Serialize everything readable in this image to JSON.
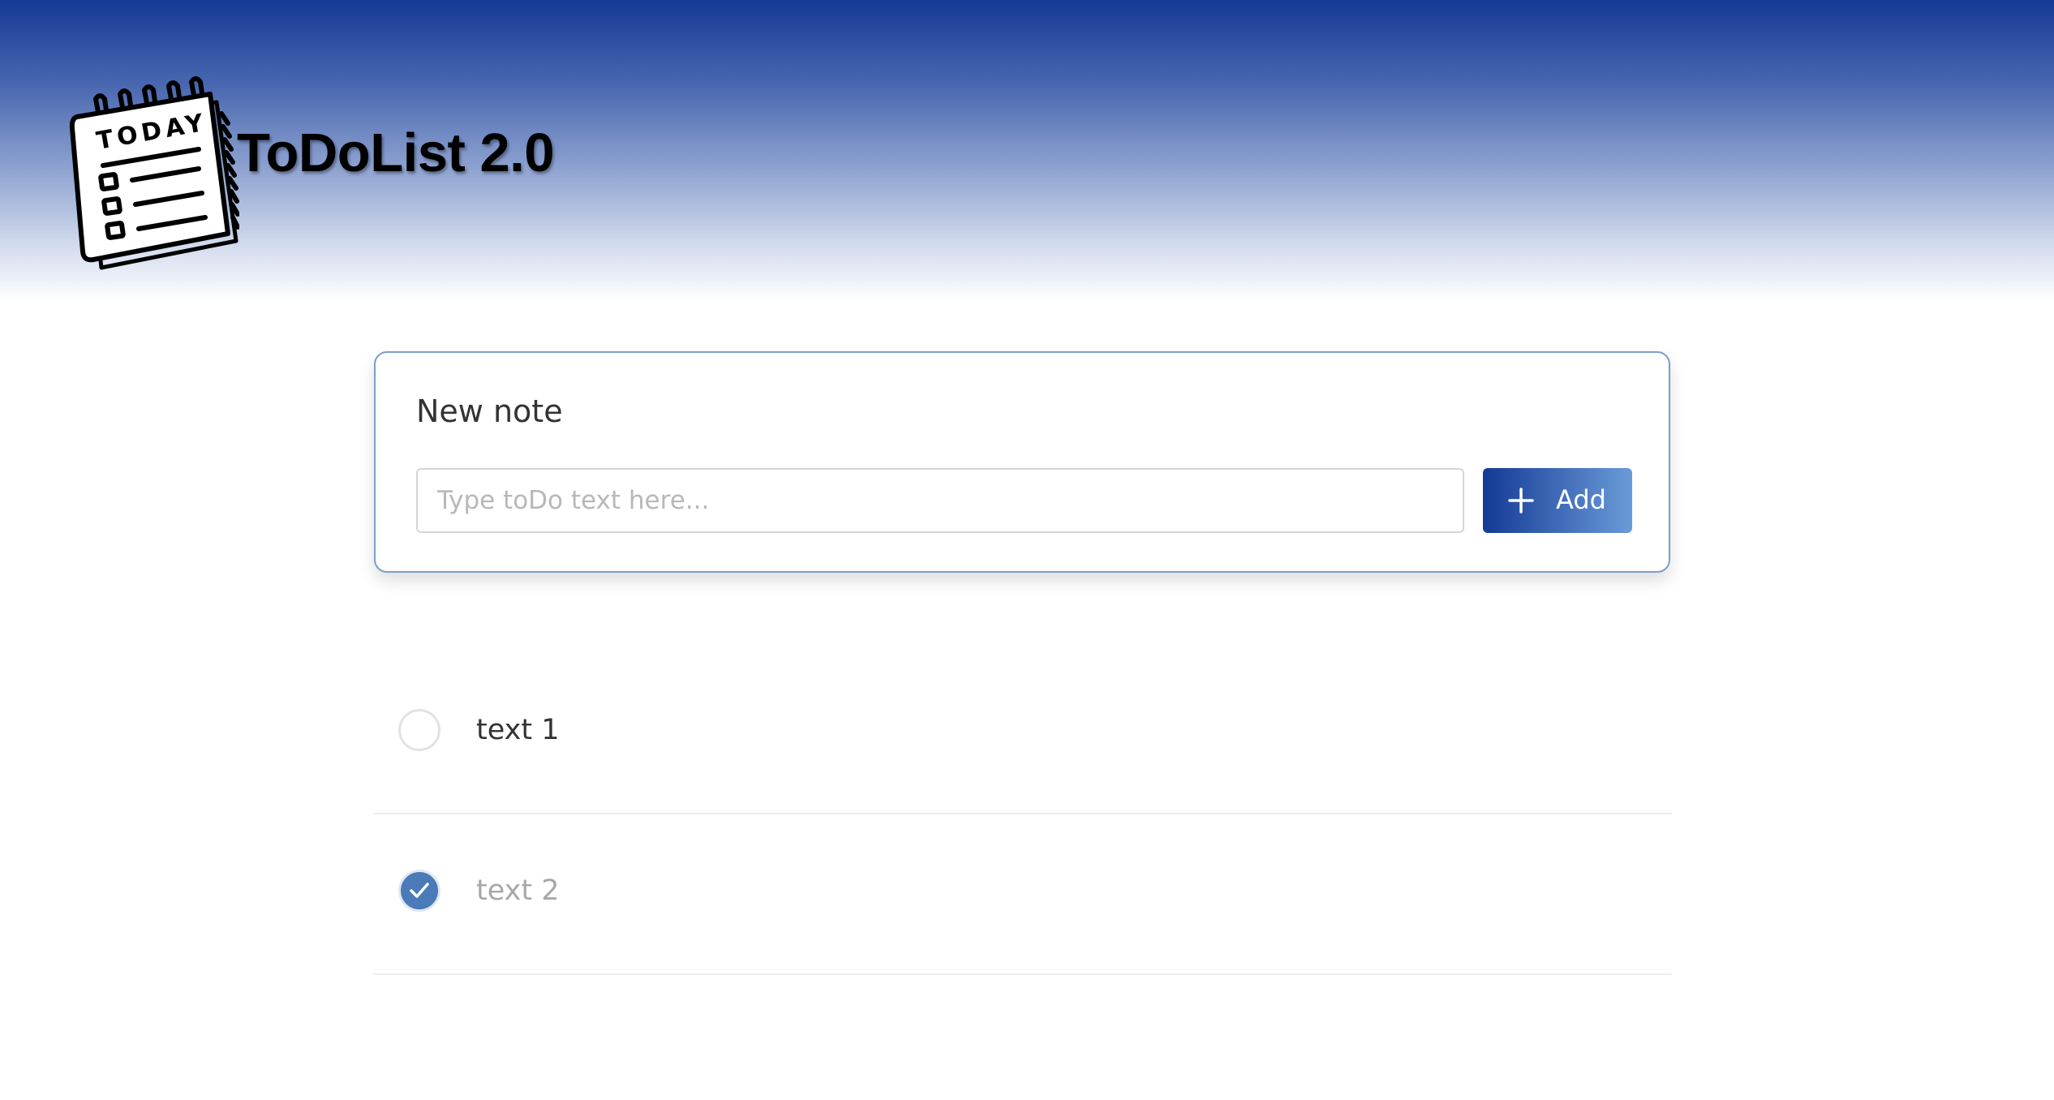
{
  "header": {
    "title": "ToDoList 2.0",
    "logo": {
      "icon": "notepad-icon",
      "text": "TODAY"
    },
    "gradient_top_color": "#143a95"
  },
  "new_note": {
    "title": "New note",
    "input": {
      "value": "",
      "placeholder": "Type toDo text here..."
    },
    "add_button": {
      "icon": "plus-icon",
      "label": "Add"
    }
  },
  "todos": [
    {
      "text": "text 1",
      "done": false
    },
    {
      "text": "text 2",
      "done": true
    }
  ],
  "colors": {
    "accent": "#4a7ab8",
    "button_gradient_start": "#143a95",
    "button_gradient_end": "#6a9bd8",
    "card_border": "#7a9fc4"
  }
}
